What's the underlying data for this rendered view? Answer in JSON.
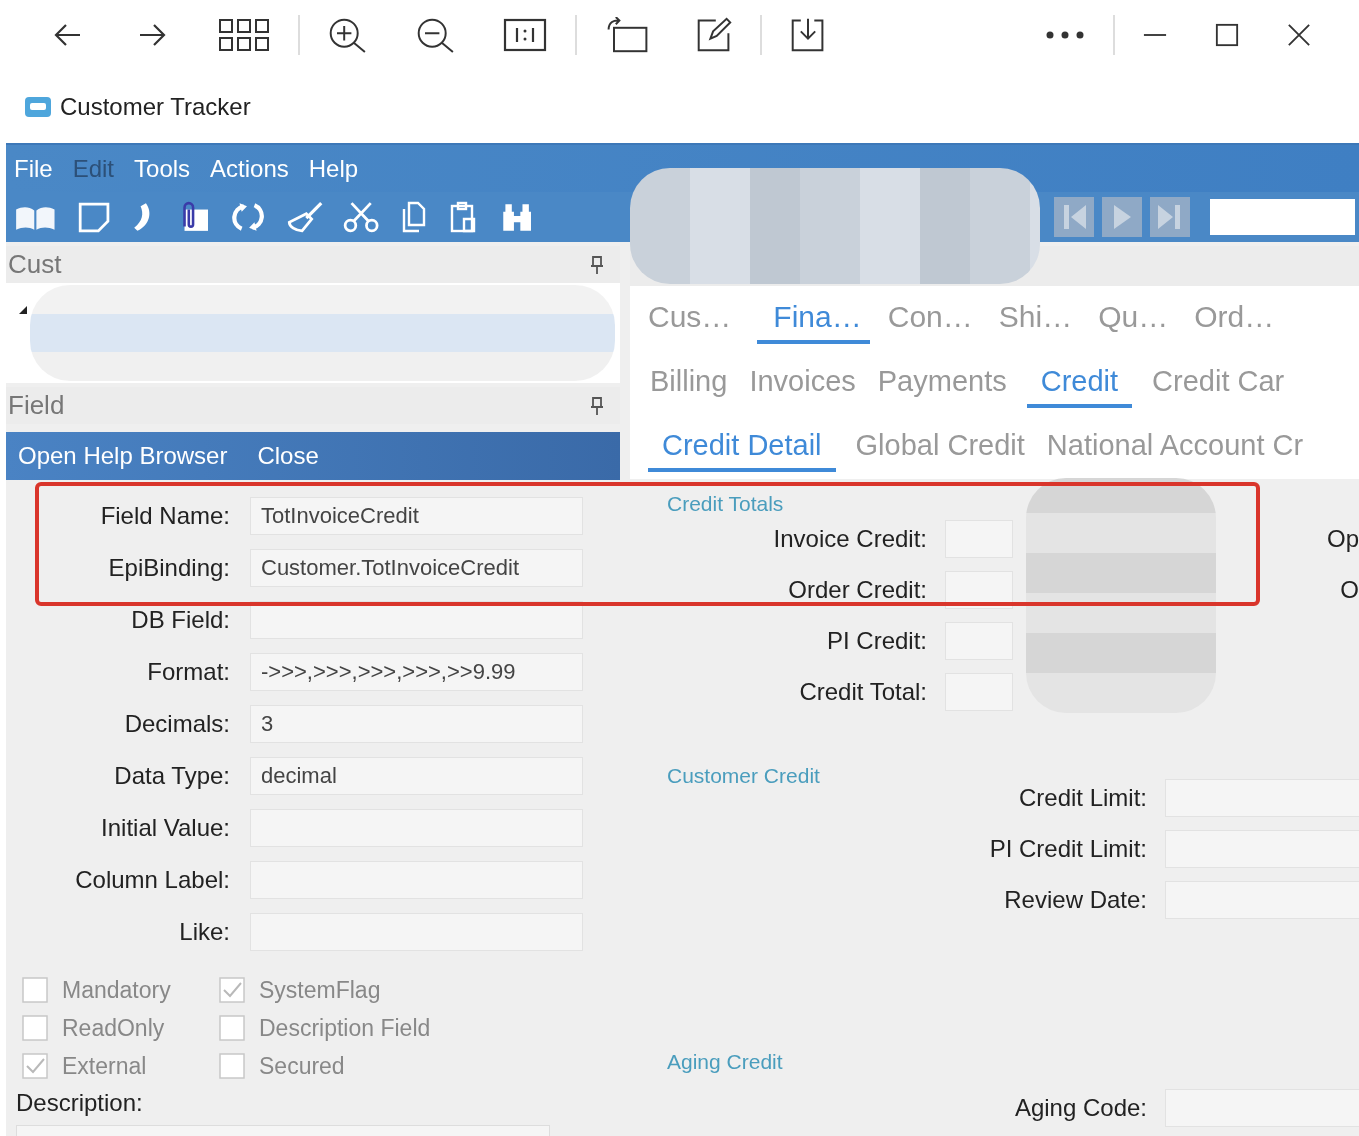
{
  "app": {
    "title": "Customer Tracker"
  },
  "menu": [
    {
      "label": "File",
      "disabled": false
    },
    {
      "label": "Edit",
      "disabled": true
    },
    {
      "label": "Tools",
      "disabled": false
    },
    {
      "label": "Actions",
      "disabled": false
    },
    {
      "label": "Help",
      "disabled": false
    }
  ],
  "left_panel": {
    "tree_header": "Cust",
    "help_header": "Field",
    "help_actions": [
      "Open Help Browser",
      "Close"
    ],
    "fields": [
      {
        "label": "Field Name:",
        "value": "TotInvoiceCredit"
      },
      {
        "label": "EpiBinding:",
        "value": "Customer.TotInvoiceCredit"
      },
      {
        "label": "DB Field:"
      },
      {
        "label": "Format:",
        "value": "->>>,>>>,>>>,>>>,>>9.99"
      },
      {
        "label": "Decimals:",
        "value": "3"
      },
      {
        "label": "Data Type:",
        "value": "decimal"
      },
      {
        "label": "Initial Value:"
      },
      {
        "label": "Column Label:"
      },
      {
        "label": "Like:"
      }
    ],
    "checkboxes": [
      {
        "label": "Mandatory",
        "checked": false
      },
      {
        "label": "SystemFlag",
        "checked": true
      },
      {
        "label": "ReadOnly",
        "checked": false
      },
      {
        "label": "Description Field",
        "checked": false
      },
      {
        "label": "External",
        "checked": true
      },
      {
        "label": "Secured",
        "checked": false
      }
    ],
    "description_label": "Description:"
  },
  "right_panel": {
    "tab_rows": [
      [
        {
          "label": "Cus…",
          "selected": false
        },
        {
          "label": "Fina…",
          "selected": true
        },
        {
          "label": "Con…",
          "selected": false
        },
        {
          "label": "Shi…",
          "selected": false
        },
        {
          "label": "Qu…",
          "selected": false
        },
        {
          "label": "Ord…",
          "selected": false
        }
      ],
      [
        {
          "label": "Billing",
          "selected": false
        },
        {
          "label": "Invoices",
          "selected": false
        },
        {
          "label": "Payments",
          "selected": false
        },
        {
          "label": "Credit",
          "selected": true
        },
        {
          "label": "Credit Car",
          "selected": false
        }
      ],
      [
        {
          "label": "Credit Detail",
          "selected": true
        },
        {
          "label": "Global Credit",
          "selected": false
        },
        {
          "label": "National Account Cr",
          "selected": false
        }
      ]
    ],
    "groups": [
      {
        "title": "Credit Totals",
        "kind": "stacked",
        "fields": [
          {
            "label": "Invoice Credit:",
            "side": "Op"
          },
          {
            "label": "Order Credit:",
            "side": "O"
          },
          {
            "label": "PI Credit:"
          },
          {
            "label": "Credit Total:"
          }
        ]
      },
      {
        "title": "Customer Credit",
        "kind": "beside",
        "fields": [
          {
            "label": "Credit Limit:"
          },
          {
            "label": "PI Credit Limit:"
          },
          {
            "label": "Review Date:"
          }
        ]
      },
      {
        "title": "Aging Credit",
        "kind": "beside",
        "fields": [
          {
            "label": "Aging Code:"
          }
        ]
      }
    ]
  }
}
